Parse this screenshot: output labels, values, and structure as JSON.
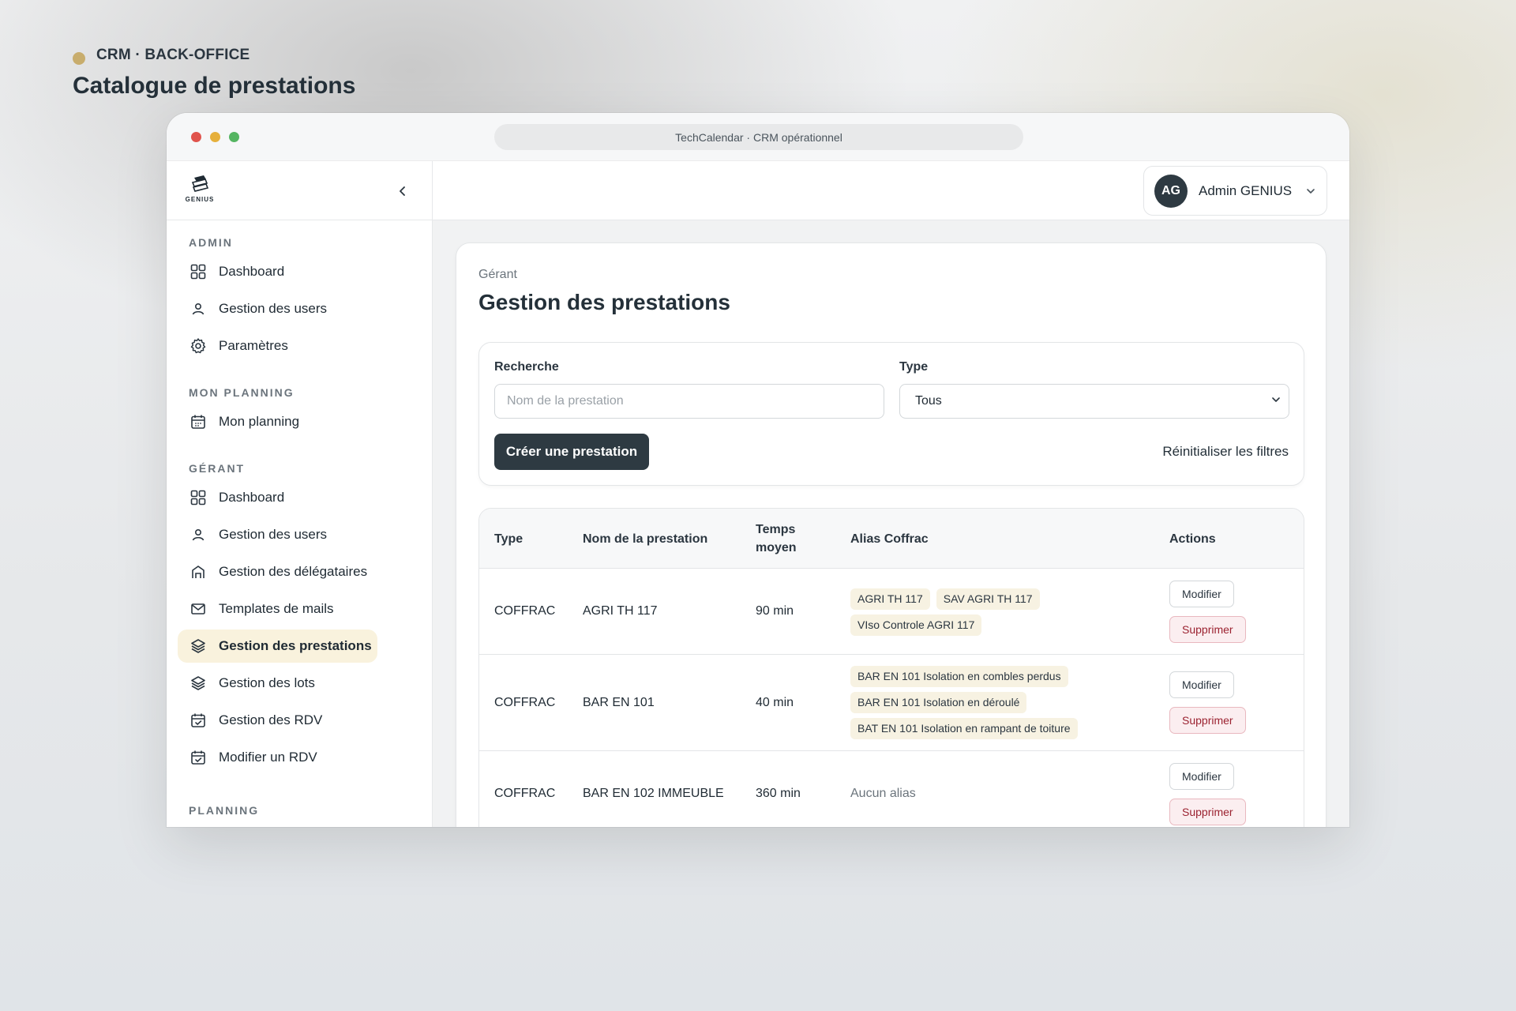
{
  "showcase": {
    "eyebrow": "CRM · BACK-OFFICE",
    "title": "Catalogue de prestations"
  },
  "browser": {
    "url_title": "TechCalendar · CRM opérationnel"
  },
  "brand": {
    "logo_text": "GENIUS",
    "accent": "#c8ad6d",
    "primary": "#2e3a42",
    "active_bg": "#f9f2dd",
    "danger": "#9b2230"
  },
  "sidebar": {
    "sections": [
      {
        "title": "ADMIN",
        "items": [
          {
            "label": "Dashboard",
            "icon": "dashboard-icon"
          },
          {
            "label": "Gestion des users",
            "icon": "user-icon"
          },
          {
            "label": "Paramètres",
            "icon": "gear-icon"
          }
        ]
      },
      {
        "title": "MON PLANNING",
        "items": [
          {
            "label": "Mon planning",
            "icon": "calendar-icon"
          }
        ]
      },
      {
        "title": "GÉRANT",
        "items": [
          {
            "label": "Dashboard",
            "icon": "dashboard-icon"
          },
          {
            "label": "Gestion des users",
            "icon": "user-icon"
          },
          {
            "label": "Gestion des délégataires",
            "icon": "building-icon"
          },
          {
            "label": "Templates de mails",
            "icon": "mail-icon"
          },
          {
            "label": "Gestion des prestations",
            "icon": "layers-icon",
            "active": true
          },
          {
            "label": "Gestion des lots",
            "icon": "layers-icon"
          },
          {
            "label": "Gestion des RDV",
            "icon": "calendar-check-icon"
          },
          {
            "label": "Modifier un RDV",
            "icon": "calendar-check-icon"
          }
        ]
      },
      {
        "title": "PLANNING",
        "items": []
      }
    ]
  },
  "user": {
    "initials": "AG",
    "name": "Admin GENIUS"
  },
  "page": {
    "breadcrumb": "Gérant",
    "title": "Gestion des prestations"
  },
  "filters": {
    "search_label": "Recherche",
    "search_placeholder": "Nom de la prestation",
    "search_value": "",
    "type_label": "Type",
    "type_value": "Tous",
    "create_button": "Créer une prestation",
    "reset_link": "Réinitialiser les filtres"
  },
  "table": {
    "headers": {
      "type": "Type",
      "name": "Nom de la prestation",
      "time_line1": "Temps",
      "time_line2": "moyen",
      "alias": "Alias Coffrac",
      "actions": "Actions"
    },
    "edit_label": "Modifier",
    "delete_label": "Supprimer",
    "rows": [
      {
        "type": "COFFRAC",
        "name": "AGRI TH 117",
        "time": "90 min",
        "aliases": [
          "AGRI TH 117",
          "SAV AGRI TH 117",
          "VIso Controle AGRI 117"
        ]
      },
      {
        "type": "COFFRAC",
        "name": "BAR EN 101",
        "time": "40 min",
        "aliases": [
          "BAR EN 101 Isolation en combles perdus",
          "BAR EN 101 Isolation en déroulé",
          "BAT EN 101 Isolation en rampant de toiture"
        ]
      },
      {
        "type": "COFFRAC",
        "name": "BAR EN 102 IMMEUBLE",
        "time": "360 min",
        "aliases": [],
        "no_alias_text": "Aucun alias"
      }
    ]
  }
}
